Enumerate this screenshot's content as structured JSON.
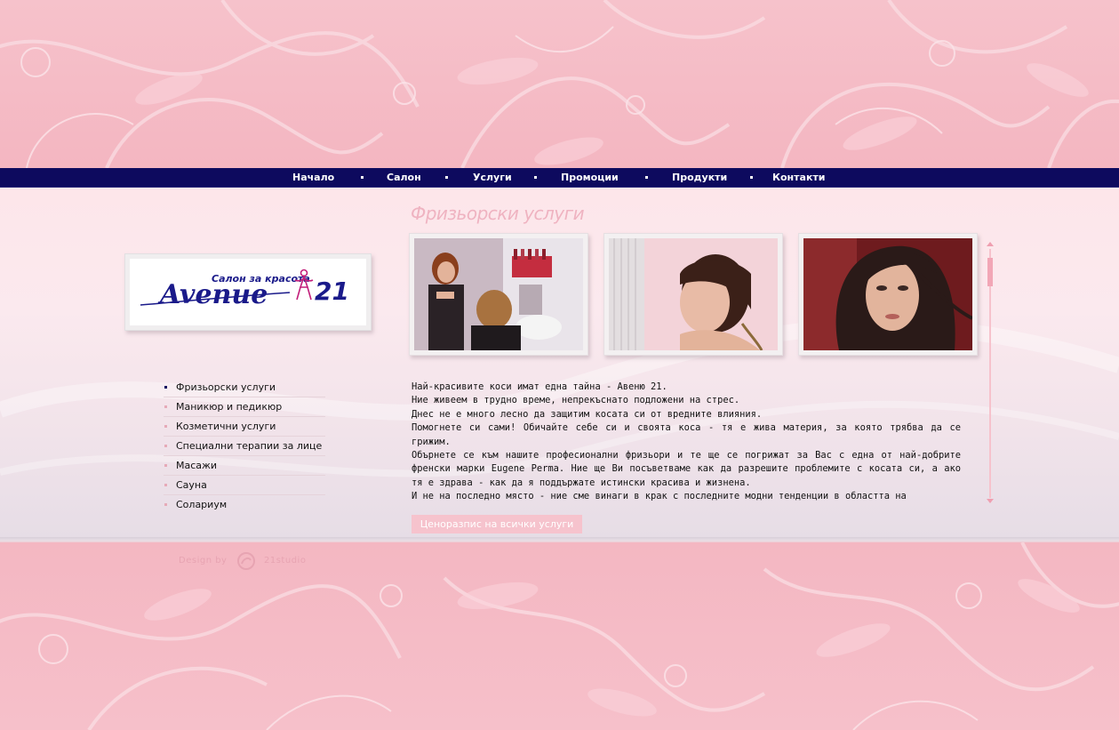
{
  "nav": {
    "items": [
      "Начало",
      "Салон",
      "Услуги",
      "Промоции",
      "Продукти",
      "Контакти"
    ]
  },
  "logo": {
    "tagline": "Салон за красота",
    "brand": "Avenue",
    "number": "21"
  },
  "side_menu": {
    "items": [
      "Фризьорски услуги",
      "Маникюр и педикюр",
      "Козметични услуги",
      "Специални терапии за лице",
      "Масажи",
      "Сауна",
      "Солариум"
    ],
    "active_index": 0
  },
  "section": {
    "title": "Фризьорски услуги"
  },
  "photos": [
    "hairdresser-photo",
    "short-hair-photo",
    "model-photo"
  ],
  "text": {
    "lines": [
      "Най-красивите коси имат една тайна - Авеню 21.",
      "Ние живеем в трудно време, непрекъснато подложени на стрес.",
      "Днес не е много лесно да защитим косата си от вредните влияния.",
      "Помогнете си сами! Обичайте себе си и своята коса - тя е жива материя, за която трябва да се грижим.",
      "Обърнете се към нашите професионални фризьори и те ще се погрижат за Вас с една от най-добрите френски марки Eugene Perma. Ние ще Ви посъветваме как да разрешите проблемите с косата си, а ако тя е здрава - как да я поддържате истински красива и жизнена.",
      "И не на последно място - ние сме винаги в крак с последните модни тенденции в областта на"
    ]
  },
  "price_button": {
    "label": "Ценоразпис на всички услуги"
  },
  "footer": {
    "design_by": "Design by",
    "studio": "21studio"
  },
  "colors": {
    "nav_bg": "#0d0a5e",
    "pink_bg": "#f5bcc6",
    "accent_pink": "#efb3c1",
    "logo_blue": "#1a1a8a",
    "logo_magenta": "#c21e7a"
  }
}
